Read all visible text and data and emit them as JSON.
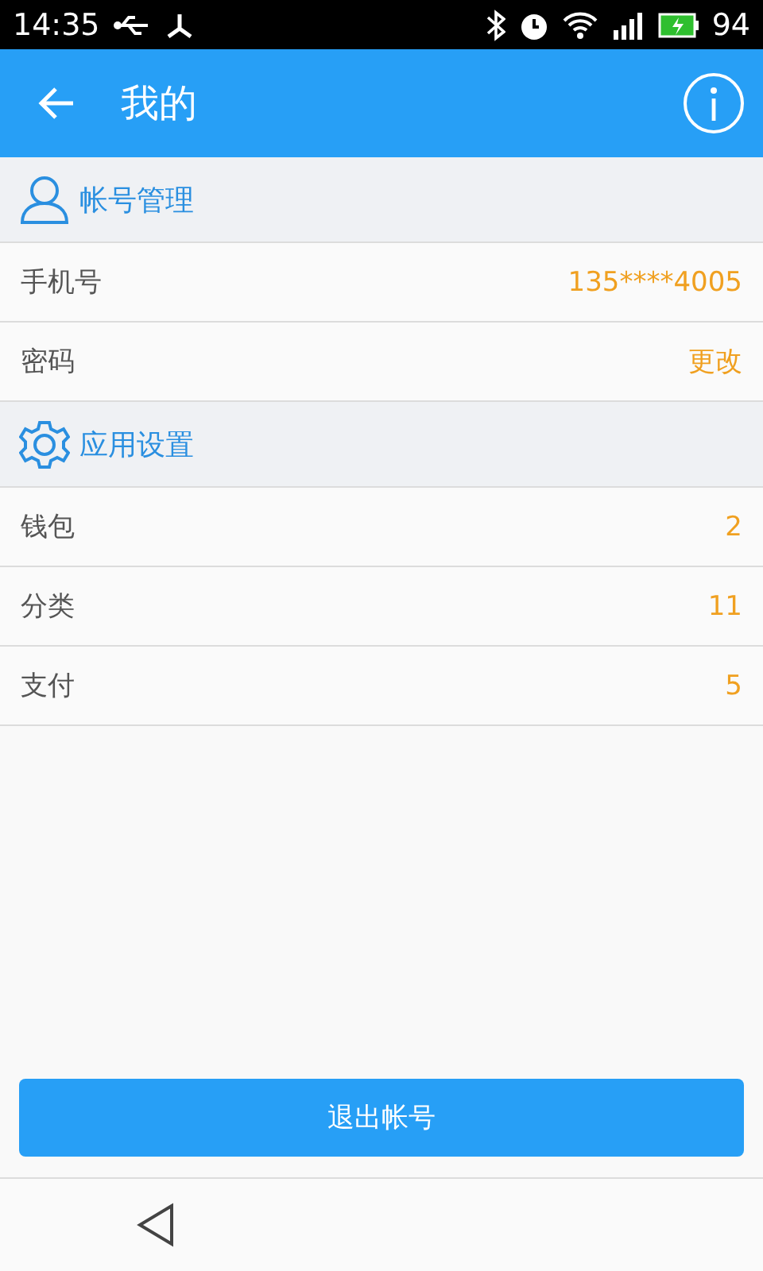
{
  "status_bar": {
    "time": "14:35",
    "battery": "94"
  },
  "header": {
    "title": "我的"
  },
  "sections": [
    {
      "kind": "account",
      "title": "帐号管理",
      "rows": [
        {
          "label": "手机号",
          "value": "135****4005"
        },
        {
          "label": "密码",
          "value": "更改"
        }
      ]
    },
    {
      "kind": "settings",
      "title": "应用设置",
      "rows": [
        {
          "label": "钱包",
          "value": "2"
        },
        {
          "label": "分类",
          "value": "11"
        },
        {
          "label": "支付",
          "value": "5"
        }
      ]
    }
  ],
  "logout_button": "退出帐号"
}
